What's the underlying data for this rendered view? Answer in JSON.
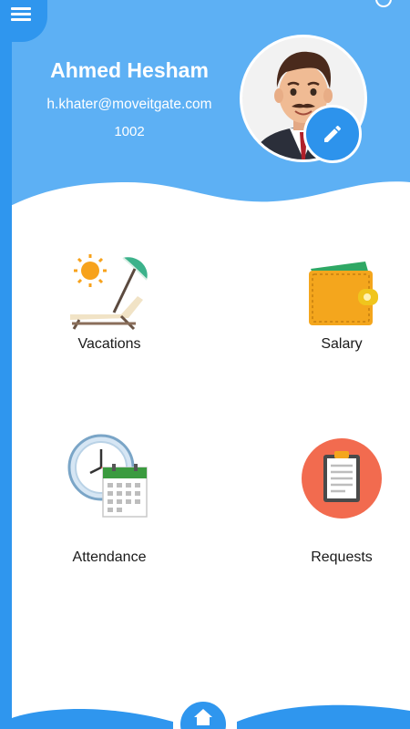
{
  "profile": {
    "name": "Ahmed Hesham",
    "email": "h.khater@moveitgate.com",
    "employee_id": "1002"
  },
  "tiles": [
    {
      "label": "Vacations",
      "icon": "beach-chair-umbrella-icon"
    },
    {
      "label": "Salary",
      "icon": "wallet-icon"
    },
    {
      "label": "Attendance",
      "icon": "clock-calendar-icon"
    },
    {
      "label": "Requests",
      "icon": "clipboard-icon"
    }
  ],
  "icons": {
    "menu": "hamburger-menu-icon",
    "edit": "pencil-icon",
    "home": "home-icon"
  },
  "colors": {
    "primary": "#2f96ee",
    "header_light": "#5db0f4",
    "requests_circle": "#f26b4f",
    "wallet": "#f4a61d"
  }
}
